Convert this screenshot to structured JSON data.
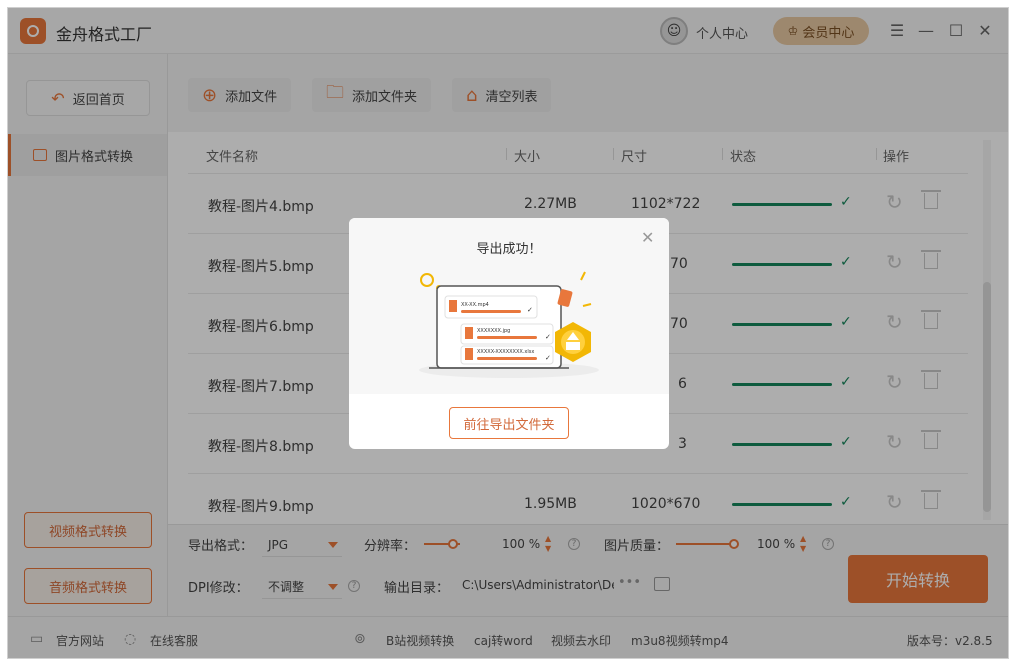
{
  "app": {
    "title": "金舟格式工厂",
    "user_center": "个人中心",
    "vip_center": "会员中心",
    "controls": [
      "menu-icon",
      "minimize-icon",
      "maximize-icon",
      "close-icon"
    ]
  },
  "sidebar": {
    "back_home": "返回首页",
    "active_item": "图片格式转换",
    "video_convert": "视频格式转换",
    "audio_convert": "音频格式转换"
  },
  "toolbar": {
    "add_file": "添加文件",
    "add_folder": "添加文件夹",
    "clear_list": "清空列表"
  },
  "table": {
    "headers": {
      "name": "文件名称",
      "size": "大小",
      "dimensions": "尺寸",
      "status": "状态",
      "actions": "操作"
    },
    "rows": [
      {
        "name": "教程-图片4.bmp",
        "size": "2.27MB",
        "dimensions": "1102*722",
        "progress": 1.0
      },
      {
        "name": "教程-图片5.bmp",
        "size": "",
        "dimensions": "70",
        "progress": 1.0
      },
      {
        "name": "教程-图片6.bmp",
        "size": "",
        "dimensions": "70",
        "progress": 1.0
      },
      {
        "name": "教程-图片7.bmp",
        "size": "",
        "dimensions": "6",
        "progress": 1.0
      },
      {
        "name": "教程-图片8.bmp",
        "size": "",
        "dimensions": "3",
        "progress": 1.0
      },
      {
        "name": "教程-图片9.bmp",
        "size": "1.95MB",
        "dimensions": "1020*670",
        "progress": 1.0
      }
    ]
  },
  "settings": {
    "export_format_label": "导出格式：",
    "export_format_value": "JPG",
    "resolution_label": "分辨率：",
    "resolution_value": "100 %",
    "quality_label": "图片质量：",
    "quality_value": "100 %",
    "dpi_label": "DPI修改：",
    "dpi_value": "不调整",
    "output_dir_label": "输出目录：",
    "output_dir_value": "C:\\Users\\Administrator\\De",
    "more": "•••",
    "start_button": "开始转换"
  },
  "statusbar": {
    "website": "官方网站",
    "service": "在线客服",
    "link1": "B站视频转换",
    "link2": "caj转word",
    "link3": "视频去水印",
    "link4": "m3u8视频转mp4",
    "version": "版本号：v2.8.5"
  },
  "modal": {
    "title": "导出成功！",
    "go_folder": "前往导出文件夹",
    "illus_file1": "XX-XX.mp4",
    "illus_file2": "XXXXXXX.jpg",
    "illus_file3": "XXXXX-XXXXXXXX.xlsx"
  },
  "colors": {
    "accent": "#e8773c",
    "success": "#16865c",
    "vip": "#e8c9a3"
  }
}
